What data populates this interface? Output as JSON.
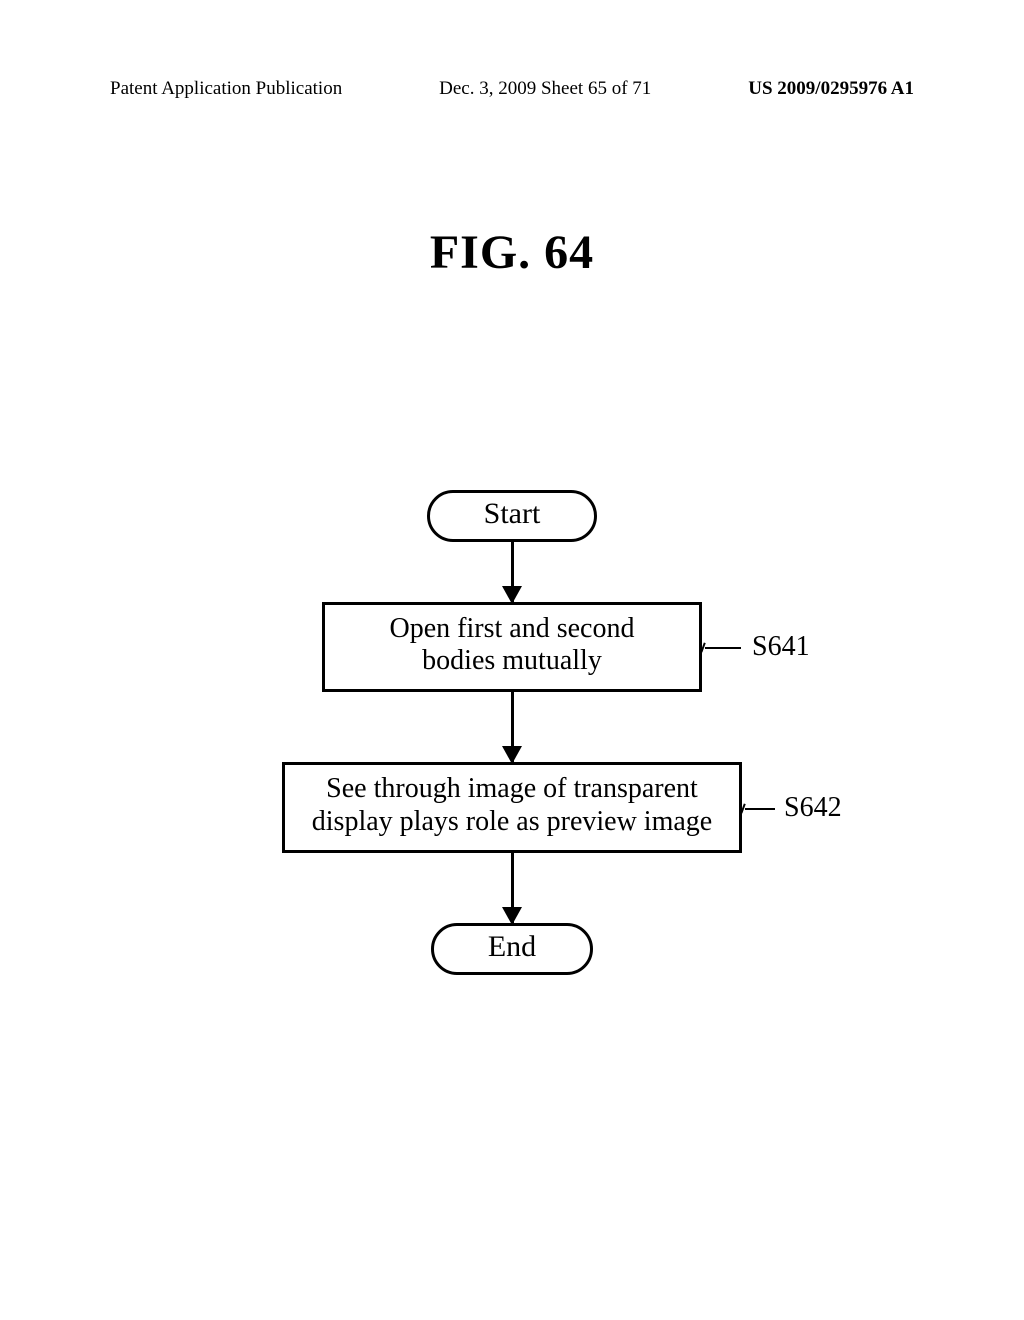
{
  "header": {
    "left": "Patent Application Publication",
    "center": "Dec. 3, 2009  Sheet 65 of 71",
    "right": "US 2009/0295976 A1"
  },
  "figure_title": "FIG. 64",
  "flow": {
    "start": "Start",
    "step1": "Open first and second\nbodies mutually",
    "step1_ref": "S641",
    "step2": "See through image of transparent\ndisplay plays role as preview image",
    "step2_ref": "S642",
    "end": "End"
  }
}
